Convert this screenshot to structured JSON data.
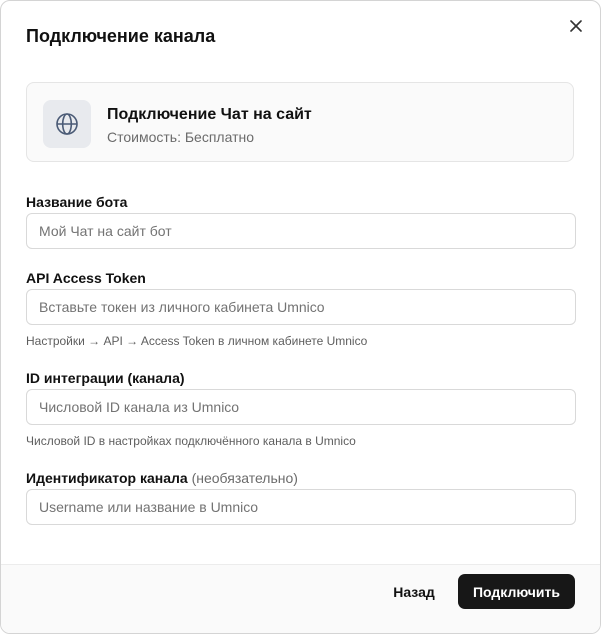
{
  "dialog": {
    "title": "Подключение канала",
    "close_icon": "close-icon"
  },
  "channel": {
    "icon": "globe-icon",
    "name": "Подключение Чат на сайт",
    "cost": "Стоимость: Бесплатно"
  },
  "fields": {
    "bot_name": {
      "label": "Название бота",
      "placeholder": "Мой Чат на сайт бот",
      "value": ""
    },
    "api_token": {
      "label": "API Access Token",
      "placeholder": "Вставьте токен из личного кабинета Umnico",
      "value": "",
      "hint": "Настройки → API → Access Token в личном кабинете Umnico"
    },
    "integration_id": {
      "label": "ID интеграции (канала)",
      "placeholder": "Числовой ID канала из Umnico",
      "value": "",
      "hint": "Числовой ID в настройках подключённого канала в Umnico"
    },
    "channel_identifier": {
      "label": "Идентификатор канала",
      "optional": "(необязательно)",
      "placeholder": "Username или название в Umnico",
      "value": ""
    }
  },
  "footer": {
    "back_label": "Назад",
    "connect_label": "Подключить"
  },
  "colors": {
    "primary_button": "#171717",
    "card_background": "#fafafa",
    "icon_background": "#e8eaee"
  }
}
